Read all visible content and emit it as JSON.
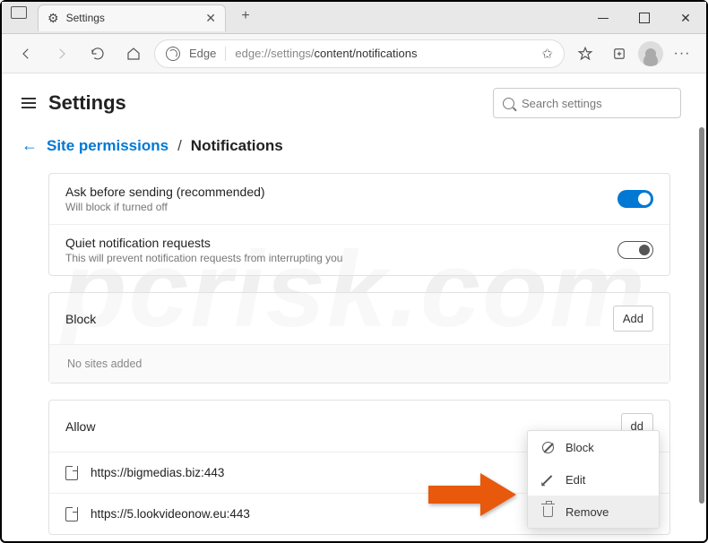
{
  "window": {
    "tab_title": "Settings",
    "address_label": "Edge",
    "url_prefix": "edge://settings/",
    "url_path": "content/notifications"
  },
  "header": {
    "title": "Settings",
    "search_placeholder": "Search settings"
  },
  "breadcrumb": {
    "parent": "Site permissions",
    "sep": "/",
    "current": "Notifications"
  },
  "settings": {
    "ask": {
      "title": "Ask before sending (recommended)",
      "desc": "Will block if turned off",
      "on": true
    },
    "quiet": {
      "title": "Quiet notification requests",
      "desc": "This will prevent notification requests from interrupting you",
      "on": false
    }
  },
  "block": {
    "label": "Block",
    "add": "Add",
    "empty": "No sites added"
  },
  "allow": {
    "label": "Allow",
    "add": "dd",
    "sites": [
      "https://bigmedias.biz:443",
      "https://5.lookvideonow.eu:443"
    ]
  },
  "ctx": {
    "block": "Block",
    "edit": "Edit",
    "remove": "Remove"
  }
}
